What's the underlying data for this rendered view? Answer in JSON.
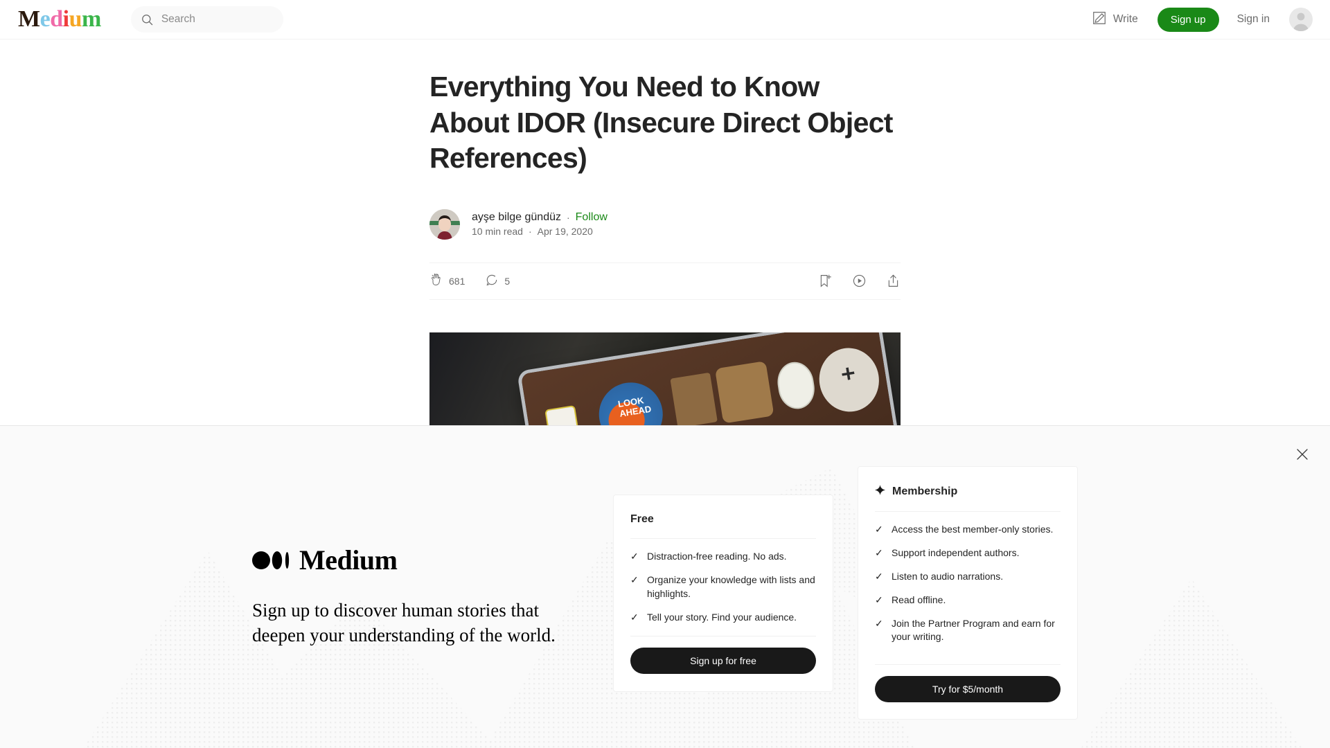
{
  "header": {
    "logo_text": "Medium",
    "logo_letters": [
      {
        "char": "M",
        "color": "#2b1a0e"
      },
      {
        "char": "e",
        "color": "#7fc8e8"
      },
      {
        "char": "d",
        "color": "#f06aa8"
      },
      {
        "char": "i",
        "color": "#ef3b3b"
      },
      {
        "char": "u",
        "color": "#f5a623"
      },
      {
        "char": "m",
        "color": "#3ab54a"
      }
    ],
    "search": {
      "placeholder": "Search",
      "value": ""
    },
    "write_label": "Write",
    "signup_label": "Sign up",
    "signin_label": "Sign in",
    "signup_color": "#1a8917"
  },
  "article": {
    "title": "Everything You Need to Know About IDOR (Insecure Direct Object References)",
    "author": "ayşe bilge gündüz",
    "follow_label": "Follow",
    "separator": "·",
    "read_time": "10 min read",
    "date": "Apr 19, 2020",
    "claps": "681",
    "comments": "5",
    "icons": {
      "clap": "clap-icon",
      "comment": "comment-icon",
      "bookmark": "bookmark-add-icon",
      "listen": "play-circle-icon",
      "share": "share-icon"
    }
  },
  "paywall": {
    "wordmark": "Medium",
    "tagline": "Sign up to discover human stories that deepen your understanding of the world.",
    "close_label": "close-icon",
    "free": {
      "title": "Free",
      "features": [
        "Distraction-free reading. No ads.",
        "Organize your knowledge with lists and highlights.",
        "Tell your story. Find your audience."
      ],
      "button": "Sign up for free"
    },
    "membership": {
      "title": "Membership",
      "features": [
        "Access the best member-only stories.",
        "Support independent authors.",
        "Listen to audio narrations.",
        "Read offline.",
        "Join the Partner Program and earn for your writing."
      ],
      "button": "Try for $5/month"
    },
    "check_glyph": "✓",
    "background_color": "#fafafa",
    "button_color": "#191919"
  }
}
